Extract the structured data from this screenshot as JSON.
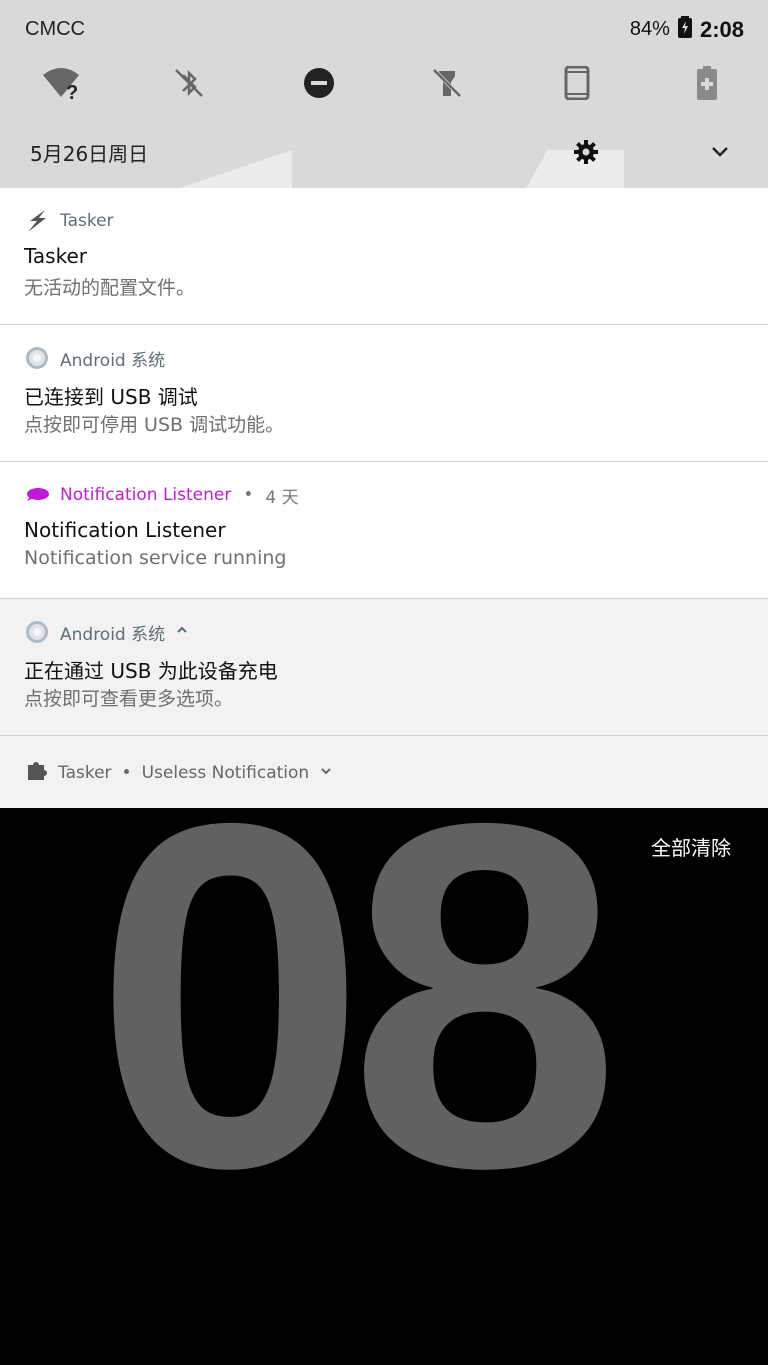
{
  "status_bar": {
    "carrier": "CMCC",
    "battery": "84%",
    "time": "2:08"
  },
  "quick_settings": {
    "tiles": [
      "wifi-unknown-icon",
      "bluetooth-off-icon",
      "do-not-disturb-icon",
      "flashlight-off-icon",
      "phone-rotate-icon",
      "battery-saver-icon"
    ],
    "date": "5月26日周日"
  },
  "notifications": [
    {
      "app": "Tasker",
      "title": "Tasker",
      "text": "无活动的配置文件。",
      "color": "#5f6f78"
    },
    {
      "app": "Android 系统",
      "title": "已连接到 USB 调试",
      "text": "点按即可停用 USB 调试功能。",
      "color": "#5f6f78"
    },
    {
      "app": "Notification Listener",
      "time": "4 天",
      "title": "Notification Listener",
      "text": "Notification service running",
      "color": "#c01bd6"
    },
    {
      "app": "Android 系统",
      "title": "正在通过 USB 为此设备充电",
      "text": "点按即可查看更多选项。",
      "color": "#5f6f78"
    }
  ],
  "collapsed": {
    "app": "Tasker",
    "text": "Useless Notification"
  },
  "clock_face": {
    "digits": "08",
    "clear_all": "全部清除"
  }
}
